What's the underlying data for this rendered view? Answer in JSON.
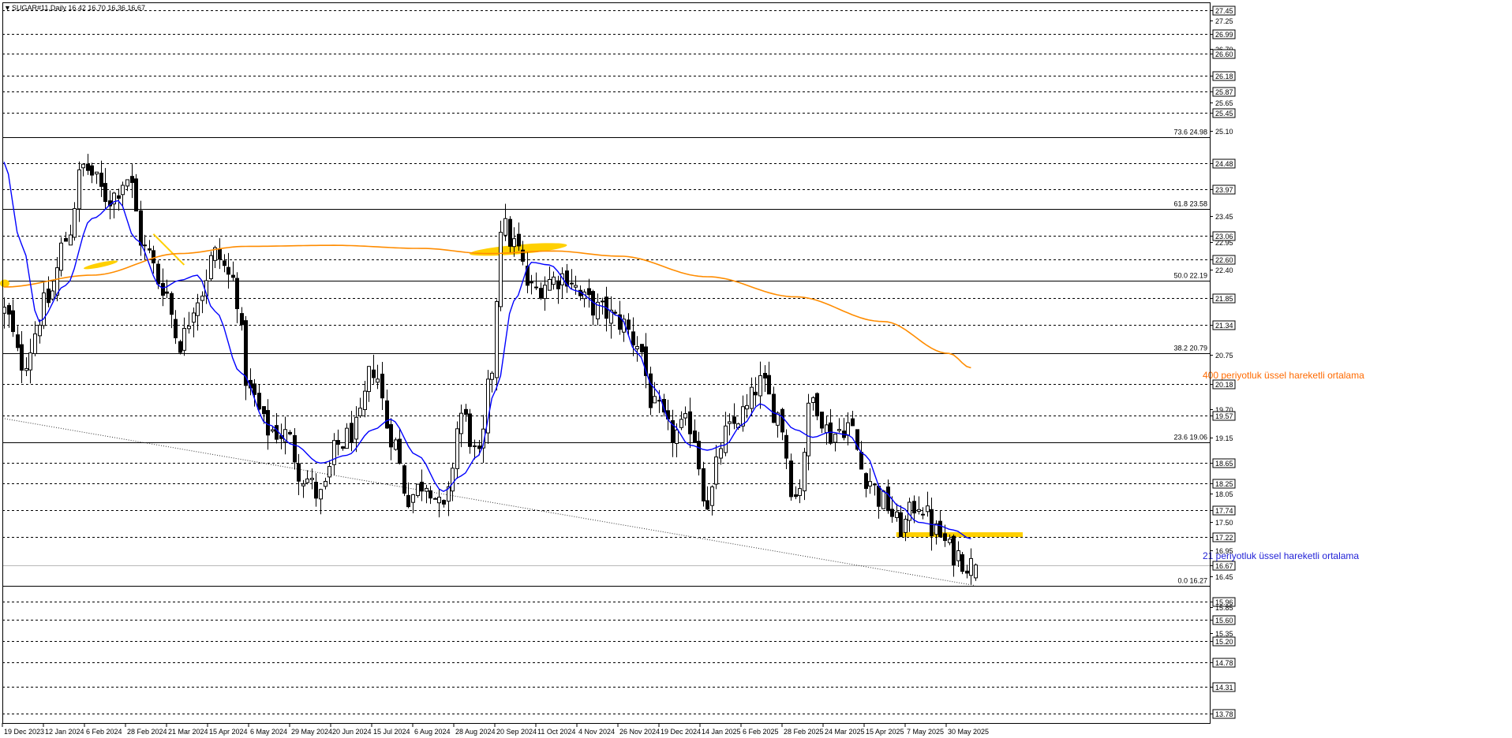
{
  "header": {
    "symbol_line": "SUGAR#11,Daily  16.42 16.70 16.36 16.67"
  },
  "chart_data": {
    "type": "candlestick",
    "ylim": [
      13.6,
      27.6
    ],
    "last_price": 16.67,
    "price_axis_labels": [
      {
        "value": 27.45,
        "boxed": true
      },
      {
        "value": 27.25,
        "boxed": false
      },
      {
        "value": 26.99,
        "boxed": true
      },
      {
        "value": 26.7,
        "boxed": false
      },
      {
        "value": 26.6,
        "boxed": true
      },
      {
        "value": 26.18,
        "boxed": true
      },
      {
        "value": 25.87,
        "boxed": true
      },
      {
        "value": 25.65,
        "boxed": false
      },
      {
        "value": 25.45,
        "boxed": true
      },
      {
        "value": 25.1,
        "boxed": false
      },
      {
        "value": 24.48,
        "boxed": true
      },
      {
        "value": 23.97,
        "boxed": true
      },
      {
        "value": 23.45,
        "boxed": false
      },
      {
        "value": 23.06,
        "boxed": true
      },
      {
        "value": 22.95,
        "boxed": false
      },
      {
        "value": 22.6,
        "boxed": true
      },
      {
        "value": 22.4,
        "boxed": false
      },
      {
        "value": 21.85,
        "boxed": true
      },
      {
        "value": 21.34,
        "boxed": true
      },
      {
        "value": 20.75,
        "boxed": false
      },
      {
        "value": 20.18,
        "boxed": true
      },
      {
        "value": 19.7,
        "boxed": false
      },
      {
        "value": 19.57,
        "boxed": true
      },
      {
        "value": 19.15,
        "boxed": false
      },
      {
        "value": 18.65,
        "boxed": true
      },
      {
        "value": 18.25,
        "boxed": true
      },
      {
        "value": 18.05,
        "boxed": false
      },
      {
        "value": 17.74,
        "boxed": true
      },
      {
        "value": 17.5,
        "boxed": false
      },
      {
        "value": 17.22,
        "boxed": true
      },
      {
        "value": 16.95,
        "boxed": false
      },
      {
        "value": 16.67,
        "boxed": true
      },
      {
        "value": 16.45,
        "boxed": false
      },
      {
        "value": 15.96,
        "boxed": true
      },
      {
        "value": 15.85,
        "boxed": false
      },
      {
        "value": 15.6,
        "boxed": true
      },
      {
        "value": 15.35,
        "boxed": false
      },
      {
        "value": 15.2,
        "boxed": true
      },
      {
        "value": 14.78,
        "boxed": true
      },
      {
        "value": 14.31,
        "boxed": true
      },
      {
        "value": 13.78,
        "boxed": true
      }
    ],
    "dashed_levels": [
      27.45,
      26.99,
      26.6,
      26.18,
      25.87,
      25.45,
      24.48,
      23.97,
      23.06,
      22.6,
      21.85,
      21.34,
      20.18,
      19.57,
      18.65,
      18.25,
      17.74,
      17.22,
      15.96,
      15.6,
      15.2,
      14.78,
      14.31,
      13.78
    ],
    "fib_levels": [
      {
        "label": "73.6 24.98",
        "value": 24.98
      },
      {
        "label": "61.8 23.58",
        "value": 23.58
      },
      {
        "label": "50.0 22.19",
        "value": 22.19
      },
      {
        "label": "38.2 20.79",
        "value": 20.79
      },
      {
        "label": "23.6 19.06",
        "value": 19.06
      },
      {
        "label": "0.0 16.27",
        "value": 16.27
      }
    ],
    "x_labels": [
      "19 Dec 2023",
      "12 Jan 2024",
      "6 Feb 2024",
      "28 Feb 2024",
      "21 Mar 2024",
      "15 Apr 2024",
      "6 May 2024",
      "29 May 2024",
      "20 Jun 2024",
      "15 Jul 2024",
      "6 Aug 2024",
      "28 Aug 2024",
      "20 Sep 2024",
      "11 Oct 2024",
      "4 Nov 2024",
      "26 Nov 2024",
      "19 Dec 2024",
      "14 Jan 2025",
      "6 Feb 2025",
      "28 Feb 2025",
      "24 Mar 2025",
      "15 Apr 2025",
      "7 May 2025",
      "30 May 2025"
    ],
    "close_anchors": [
      {
        "i": 0,
        "v": 21.6
      },
      {
        "i": 4,
        "v": 20.6
      },
      {
        "i": 10,
        "v": 21.8
      },
      {
        "i": 14,
        "v": 23.0
      },
      {
        "i": 18,
        "v": 24.4
      },
      {
        "i": 24,
        "v": 23.8
      },
      {
        "i": 28,
        "v": 24.2
      },
      {
        "i": 32,
        "v": 22.8
      },
      {
        "i": 36,
        "v": 22.1
      },
      {
        "i": 40,
        "v": 21.0
      },
      {
        "i": 44,
        "v": 21.9
      },
      {
        "i": 48,
        "v": 22.7
      },
      {
        "i": 52,
        "v": 22.2
      },
      {
        "i": 56,
        "v": 20.0
      },
      {
        "i": 60,
        "v": 19.3
      },
      {
        "i": 64,
        "v": 19.2
      },
      {
        "i": 68,
        "v": 18.4
      },
      {
        "i": 72,
        "v": 18.0
      },
      {
        "i": 76,
        "v": 19.0
      },
      {
        "i": 80,
        "v": 19.3
      },
      {
        "i": 84,
        "v": 20.5
      },
      {
        "i": 88,
        "v": 19.2
      },
      {
        "i": 92,
        "v": 18.0
      },
      {
        "i": 96,
        "v": 18.3
      },
      {
        "i": 100,
        "v": 17.7
      },
      {
        "i": 104,
        "v": 19.6
      },
      {
        "i": 108,
        "v": 18.7
      },
      {
        "i": 111,
        "v": 20.5
      },
      {
        "i": 113,
        "v": 23.3
      },
      {
        "i": 116,
        "v": 22.9
      },
      {
        "i": 120,
        "v": 22.0
      },
      {
        "i": 124,
        "v": 22.2
      },
      {
        "i": 128,
        "v": 22.3
      },
      {
        "i": 132,
        "v": 21.8
      },
      {
        "i": 136,
        "v": 21.6
      },
      {
        "i": 140,
        "v": 21.4
      },
      {
        "i": 144,
        "v": 21.0
      },
      {
        "i": 148,
        "v": 19.7
      },
      {
        "i": 152,
        "v": 19.2
      },
      {
        "i": 156,
        "v": 19.4
      },
      {
        "i": 160,
        "v": 17.9
      },
      {
        "i": 164,
        "v": 19.2
      },
      {
        "i": 168,
        "v": 19.6
      },
      {
        "i": 172,
        "v": 20.2
      },
      {
        "i": 176,
        "v": 19.6
      },
      {
        "i": 180,
        "v": 18.0
      },
      {
        "i": 184,
        "v": 19.9
      },
      {
        "i": 188,
        "v": 19.2
      },
      {
        "i": 192,
        "v": 19.4
      },
      {
        "i": 196,
        "v": 18.4
      },
      {
        "i": 200,
        "v": 17.9
      },
      {
        "i": 204,
        "v": 17.4
      },
      {
        "i": 208,
        "v": 17.9
      },
      {
        "i": 212,
        "v": 17.3
      },
      {
        "i": 216,
        "v": 16.9
      },
      {
        "i": 220,
        "v": 16.67
      }
    ],
    "series": [
      {
        "name": "400 periyotluk üssel hareketli ortalama",
        "points": [
          {
            "i": 0,
            "v": 22.07
          },
          {
            "i": 20,
            "v": 22.3
          },
          {
            "i": 40,
            "v": 22.72
          },
          {
            "i": 55,
            "v": 22.86
          },
          {
            "i": 75,
            "v": 22.88
          },
          {
            "i": 95,
            "v": 22.82
          },
          {
            "i": 110,
            "v": 22.72
          },
          {
            "i": 125,
            "v": 22.77
          },
          {
            "i": 140,
            "v": 22.67
          },
          {
            "i": 160,
            "v": 22.27
          },
          {
            "i": 180,
            "v": 21.88
          },
          {
            "i": 200,
            "v": 21.4
          },
          {
            "i": 215,
            "v": 20.78
          },
          {
            "i": 220,
            "v": 20.5
          }
        ]
      },
      {
        "name": "21 periyotluk üssel hareketli ortalama",
        "points": [
          {
            "i": 0,
            "v": 24.5
          },
          {
            "i": 4,
            "v": 22.9
          },
          {
            "i": 8,
            "v": 21.4
          },
          {
            "i": 14,
            "v": 22.1
          },
          {
            "i": 20,
            "v": 23.4
          },
          {
            "i": 26,
            "v": 23.75
          },
          {
            "i": 30,
            "v": 23.0
          },
          {
            "i": 36,
            "v": 22.05
          },
          {
            "i": 40,
            "v": 22.2
          },
          {
            "i": 44,
            "v": 22.3
          },
          {
            "i": 48,
            "v": 21.6
          },
          {
            "i": 54,
            "v": 20.4
          },
          {
            "i": 60,
            "v": 19.4
          },
          {
            "i": 66,
            "v": 19.0
          },
          {
            "i": 72,
            "v": 18.65
          },
          {
            "i": 78,
            "v": 18.8
          },
          {
            "i": 84,
            "v": 19.3
          },
          {
            "i": 88,
            "v": 19.5
          },
          {
            "i": 94,
            "v": 18.8
          },
          {
            "i": 100,
            "v": 18.1
          },
          {
            "i": 104,
            "v": 18.4
          },
          {
            "i": 108,
            "v": 18.8
          },
          {
            "i": 112,
            "v": 20.1
          },
          {
            "i": 116,
            "v": 21.8
          },
          {
            "i": 120,
            "v": 22.55
          },
          {
            "i": 124,
            "v": 22.5
          },
          {
            "i": 130,
            "v": 22.0
          },
          {
            "i": 136,
            "v": 21.7
          },
          {
            "i": 140,
            "v": 21.5
          },
          {
            "i": 144,
            "v": 20.8
          },
          {
            "i": 148,
            "v": 20.1
          },
          {
            "i": 152,
            "v": 19.4
          },
          {
            "i": 156,
            "v": 19.0
          },
          {
            "i": 160,
            "v": 18.9
          },
          {
            "i": 164,
            "v": 19.0
          },
          {
            "i": 168,
            "v": 19.4
          },
          {
            "i": 172,
            "v": 19.8
          },
          {
            "i": 176,
            "v": 19.6
          },
          {
            "i": 180,
            "v": 19.3
          },
          {
            "i": 184,
            "v": 19.15
          },
          {
            "i": 188,
            "v": 19.25
          },
          {
            "i": 192,
            "v": 19.2
          },
          {
            "i": 196,
            "v": 18.8
          },
          {
            "i": 200,
            "v": 18.1
          },
          {
            "i": 204,
            "v": 17.8
          },
          {
            "i": 208,
            "v": 17.5
          },
          {
            "i": 212,
            "v": 17.45
          },
          {
            "i": 216,
            "v": 17.35
          },
          {
            "i": 220,
            "v": 17.18
          }
        ]
      }
    ],
    "annotations": [
      {
        "text": "400 periyotluk üssel hareketli ortalama",
        "color": "#ff6a00"
      },
      {
        "text": "21 periyotluk üssel hareketli ortalama",
        "color": "#1f1fd6"
      }
    ],
    "colors": {
      "candle": "#000000",
      "ema400": "#ff8c00",
      "ema21": "#0000ff",
      "highlight": "#ffd000",
      "background": "#ffffff"
    }
  }
}
